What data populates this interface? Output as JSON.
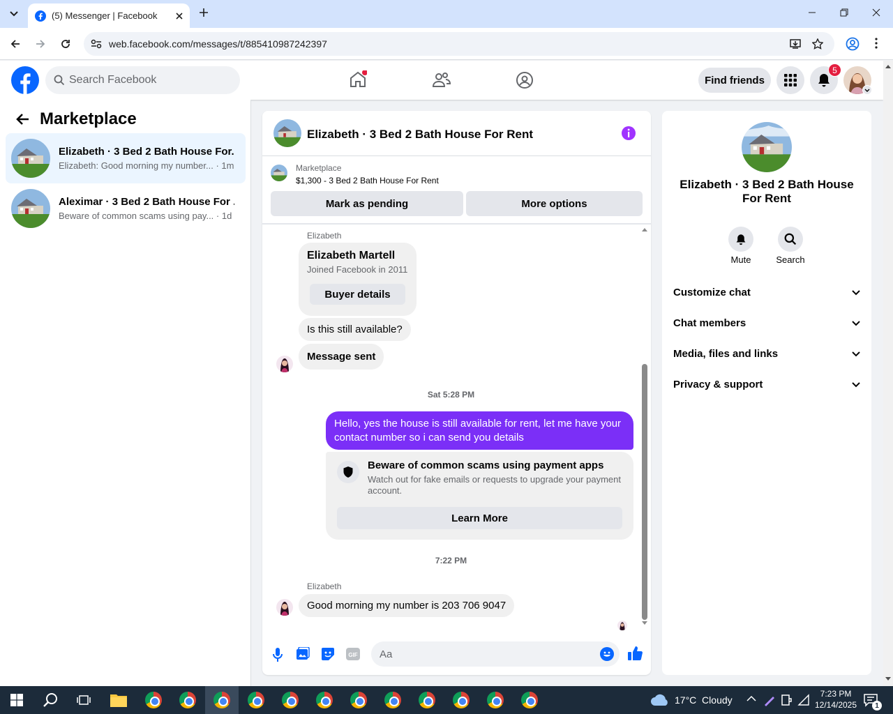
{
  "browser": {
    "tab_title": "(5) Messenger | Facebook",
    "url": "web.facebook.com/messages/t/885410987242397"
  },
  "header": {
    "search_placeholder": "Search Facebook",
    "find_friends": "Find friends",
    "notif_count": "5"
  },
  "left": {
    "title": "Marketplace",
    "conversations": [
      {
        "name": "Elizabeth · 3 Bed 2 Bath House For...",
        "preview": "Elizabeth: Good morning my number...",
        "time": "· 1m"
      },
      {
        "name": "Aleximar · 3 Bed 2 Bath House For ...",
        "preview": "Beware of common scams using pay...",
        "time": "· 1d"
      }
    ]
  },
  "chat": {
    "title": "Elizabeth · 3 Bed 2 Bath House For Rent",
    "listing_label": "Marketplace",
    "listing_title": "$1,300 - 3 Bed 2 Bath House For Rent",
    "mark_pending": "Mark as pending",
    "more_options": "More options",
    "sender1": "Elizabeth",
    "profile_name": "Elizabeth Martell",
    "profile_joined": "Joined Facebook in 2011",
    "buyer_details": "Buyer details",
    "msg_available": "Is this still available?",
    "msg_sent": "Message sent",
    "ts1": "Sat 5:28 PM",
    "msg_out": "Hello, yes the house is still available for rent, let me have your contact number so i can send you  details",
    "scam_title": "Beware of common scams using payment apps",
    "scam_body": "Watch out for fake emails or requests to upgrade your payment account.",
    "learn_more": "Learn More",
    "ts2": "7:22 PM",
    "sender2": "Elizabeth",
    "msg_last": "Good morning my number is 203 706 9047",
    "composer_placeholder": "Aa"
  },
  "right": {
    "name": "Elizabeth · 3 Bed 2 Bath House For Rent",
    "mute": "Mute",
    "search": "Search",
    "sections": [
      "Customize chat",
      "Chat members",
      "Media, files and links",
      "Privacy & support"
    ]
  },
  "taskbar": {
    "weather": "17°C  Cloudy",
    "time": "7:23 PM",
    "date": "12/14/2025",
    "notif": "1"
  },
  "colors": {
    "fb_blue": "#0866ff",
    "messenger_purple": "#7b2ff7",
    "accent_purple": "#a033ff"
  }
}
